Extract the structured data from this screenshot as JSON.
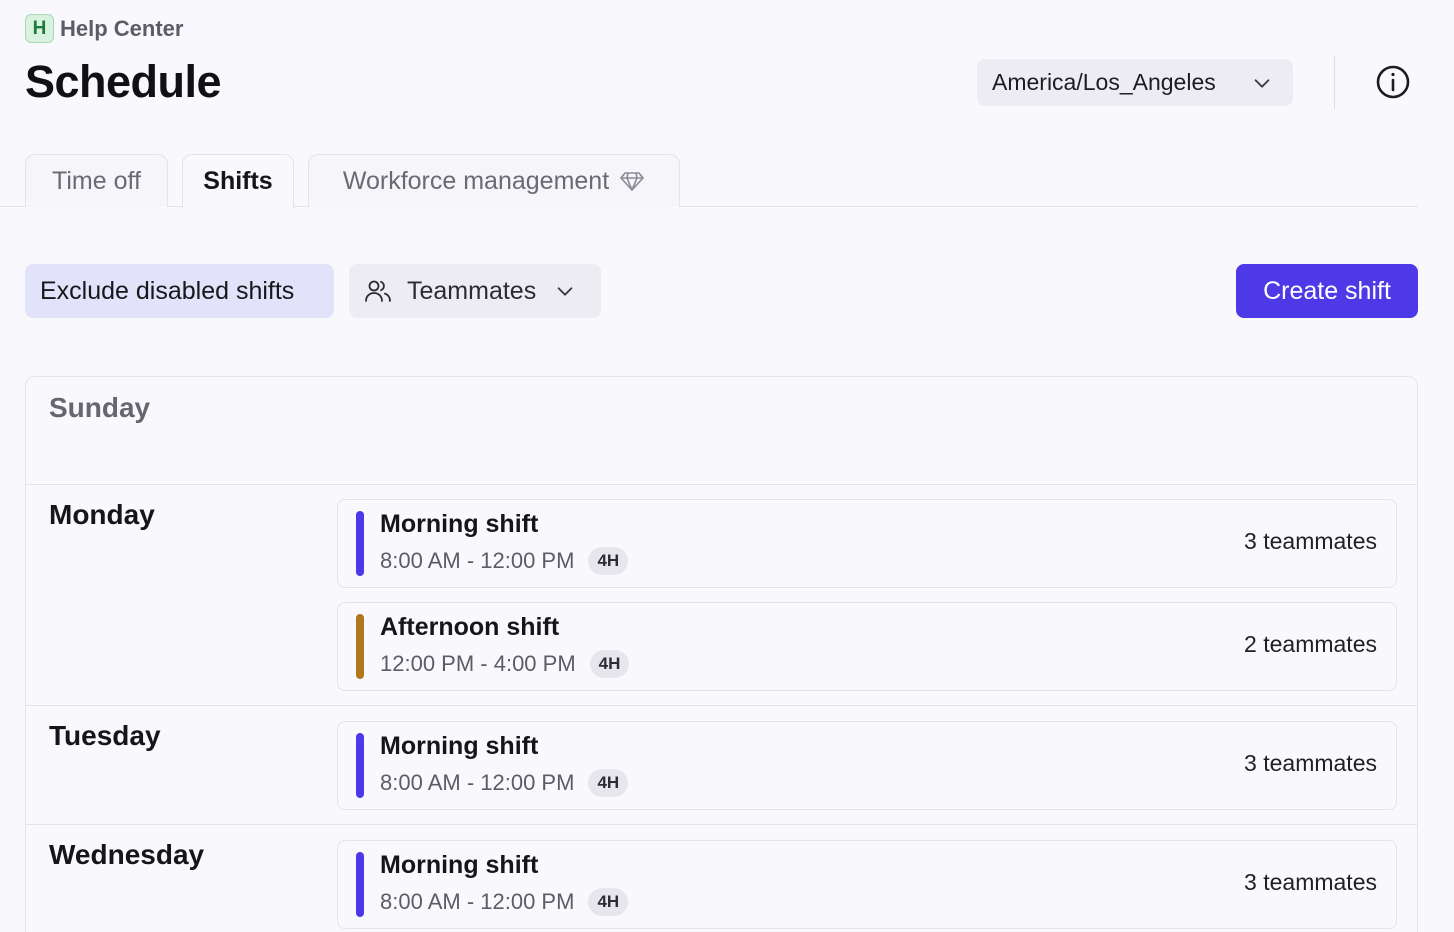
{
  "workspace": {
    "badge": "H",
    "name": "Help Center"
  },
  "header": {
    "title": "Schedule",
    "timezone": "America/Los_Angeles"
  },
  "tabs": [
    {
      "label": "Time off",
      "active": false
    },
    {
      "label": "Shifts",
      "active": true
    },
    {
      "label": "Workforce management",
      "active": false,
      "icon": "diamond-icon"
    }
  ],
  "toolbar": {
    "exclude_label": "Exclude disabled shifts",
    "teammates_label": "Teammates",
    "create_label": "Create shift"
  },
  "colors": {
    "accent": "#4e39e8",
    "morning": "#4e39e8",
    "afternoon": "#b0781b"
  },
  "days": [
    {
      "name": "Sunday",
      "shifts": []
    },
    {
      "name": "Monday",
      "shifts": [
        {
          "name": "Morning shift",
          "time": "8:00 AM - 12:00 PM",
          "duration": "4H",
          "count": "3 teammates",
          "color": "#4e39e8"
        },
        {
          "name": "Afternoon shift",
          "time": "12:00 PM - 4:00 PM",
          "duration": "4H",
          "count": "2 teammates",
          "color": "#b0781b"
        }
      ]
    },
    {
      "name": "Tuesday",
      "shifts": [
        {
          "name": "Morning shift",
          "time": "8:00 AM - 12:00 PM",
          "duration": "4H",
          "count": "3 teammates",
          "color": "#4e39e8"
        }
      ]
    },
    {
      "name": "Wednesday",
      "shifts": [
        {
          "name": "Morning shift",
          "time": "8:00 AM - 12:00 PM",
          "duration": "4H",
          "count": "3 teammates",
          "color": "#4e39e8"
        }
      ]
    }
  ]
}
